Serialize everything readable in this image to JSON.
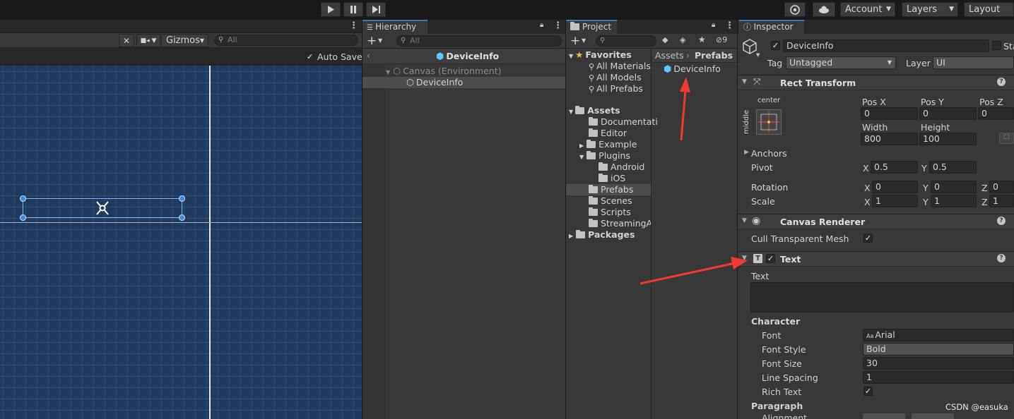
{
  "toolbar": {
    "account": "Account",
    "layers": "Layers",
    "layout": "Layout"
  },
  "scene": {
    "gizmos": "Gizmos",
    "search_placeholder": "All",
    "auto_save": "Auto Save"
  },
  "hierarchy": {
    "tab": "Hierarchy",
    "search_placeholder": "All",
    "breadcrumb": "DeviceInfo",
    "items": [
      "Canvas (Environment)",
      "DeviceInfo"
    ]
  },
  "project": {
    "tab": "Project",
    "hidden_count": "9",
    "favorites_label": "Favorites",
    "favorites": [
      "All Materials",
      "All Models",
      "All Prefabs"
    ],
    "assets_label": "Assets",
    "folders": [
      "Documentati",
      "Editor",
      "Example",
      "Plugins",
      "Android",
      "iOS",
      "Prefabs",
      "Scenes",
      "Scripts",
      "StreamingAs"
    ],
    "packages_label": "Packages",
    "crumb_assets": "Assets",
    "crumb_prefabs": "Prefabs",
    "asset_item": "DeviceInfo"
  },
  "inspector": {
    "tab": "Inspector",
    "object_name": "DeviceInfo",
    "static_label": "Sta",
    "tag_label": "Tag",
    "tag_value": "Untagged",
    "layer_label": "Layer",
    "layer_value": "UI",
    "rect": {
      "title": "Rect Transform",
      "anchor_h": "center",
      "anchor_v": "middle",
      "pos_x_label": "Pos X",
      "pos_y_label": "Pos Y",
      "pos_z_label": "Pos Z",
      "pos_x": "0",
      "pos_y": "0",
      "pos_z": "0",
      "width_label": "Width",
      "height_label": "Height",
      "width": "800",
      "height": "100",
      "anchors_label": "Anchors",
      "pivot_label": "Pivot",
      "pivot_x": "0.5",
      "pivot_y": "0.5",
      "rotation_label": "Rotation",
      "rot_x": "0",
      "rot_y": "0",
      "rot_z": "0",
      "scale_label": "Scale",
      "scale_x": "1",
      "scale_y": "1",
      "scale_z": "1",
      "x": "X",
      "y": "Y",
      "z": "Z"
    },
    "canvas_renderer": {
      "title": "Canvas Renderer",
      "cull_label": "Cull Transparent Mesh"
    },
    "text": {
      "title": "Text",
      "text_label": "Text",
      "character_label": "Character",
      "font_label": "Font",
      "font_value": "Arial",
      "font_style_label": "Font Style",
      "font_style_value": "Bold",
      "font_size_label": "Font Size",
      "font_size_value": "30",
      "line_spacing_label": "Line Spacing",
      "line_spacing_value": "1",
      "rich_text_label": "Rich Text",
      "paragraph_label": "Paragraph",
      "alignment_label": "Alignment"
    }
  },
  "watermark": "CSDN @easuka",
  "colors": {
    "scene_bg": "#1f3a5c",
    "accent": "#3a79bb",
    "arrow": "#f03a32"
  }
}
